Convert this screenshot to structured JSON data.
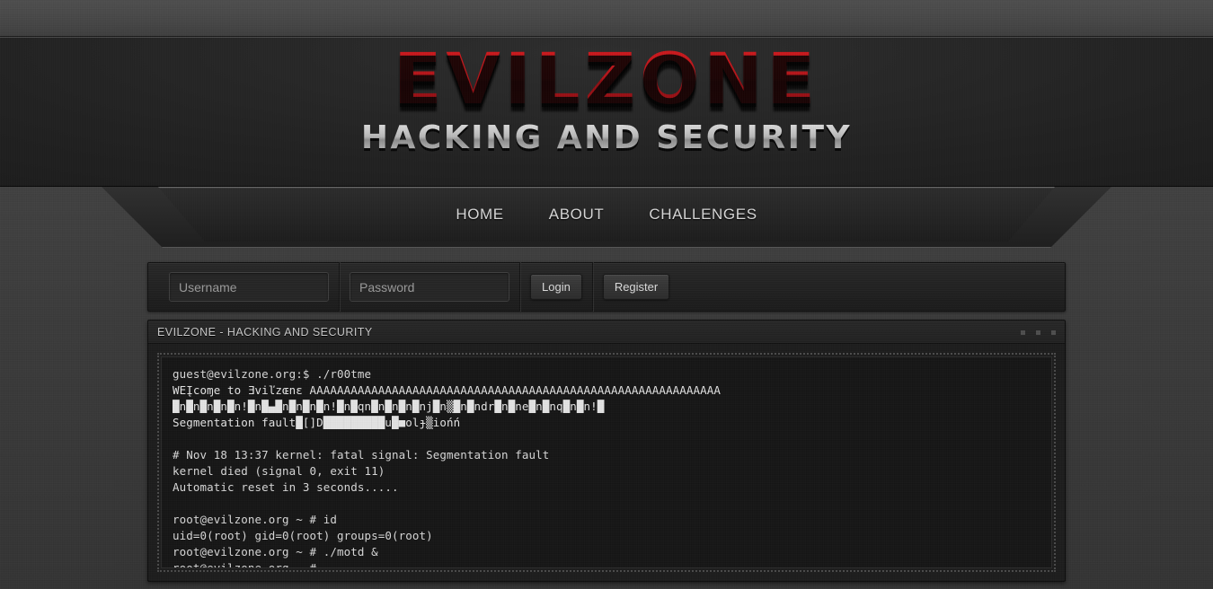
{
  "site": {
    "logo_main": "EVILZONE",
    "logo_sub": "HACKING AND SECURITY"
  },
  "nav": {
    "items": [
      {
        "label": "HOME"
      },
      {
        "label": "ABOUT"
      },
      {
        "label": "CHALLENGES"
      }
    ]
  },
  "login": {
    "username_placeholder": "Username",
    "username_value": "",
    "password_placeholder": "Password",
    "password_value": "",
    "login_label": "Login",
    "register_label": "Register"
  },
  "terminal": {
    "title": "EVILZONE - HACKING AND SECURITY",
    "window_dots": [
      "minimize-dot",
      "maximize-dot",
      "close-dot"
    ],
    "lines": [
      "guest@evilzone.org:$ ./r00tme",
      "WEĮcoɱe to Ǝviľzɶnɛ AAAAAAAAAAAAAAAAAAAAAAAAAAAAAAAAAAAAAAAAAAAAAAAAAAAAAAAAAAAA",
      "█n█n█n█n█n!█n█▄█n█n█n█n!█n█qn█n█n█n█nj█n▒█n█ndr█n█ne█n█nq█n█n!█",
      "Segmentation fault█[]D█████████u█■olɟ▒iońń",
      "",
      "# Nov 18 13:37 kernel: fatal signal: Segmentation fault",
      "kernel died (signal 0, exit 11)",
      "Automatic reset in 3 seconds.....",
      "",
      "root@evilzone.org ~ # id",
      "uid=0(root) gid=0(root) groups=0(root)",
      "root@evilzone.org ~ # ./motd &",
      "root@evilzone.org ~ #"
    ]
  },
  "colors": {
    "accent_red": "#b01016",
    "page_bg": "#3a3a3a",
    "header_bg": "#1a1a1a",
    "terminal_bg": "#161616",
    "terminal_text": "#d7d7d7"
  }
}
